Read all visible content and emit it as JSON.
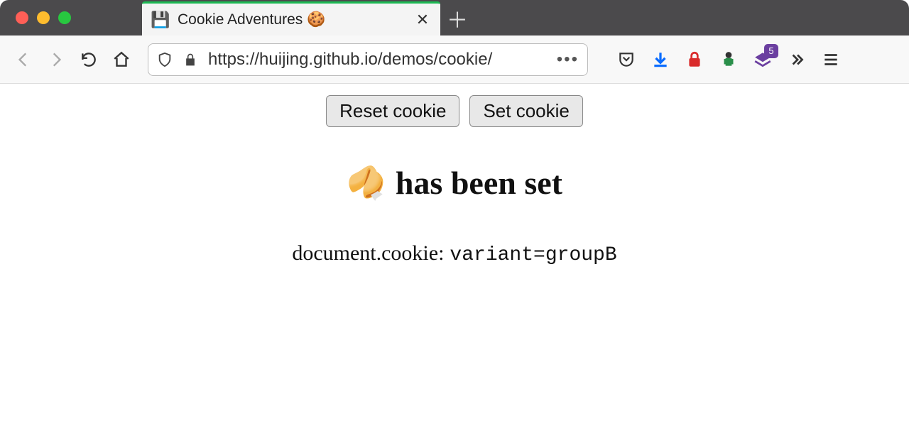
{
  "browser": {
    "tab": {
      "title": "Cookie Adventures 🍪",
      "favicon": "💾"
    },
    "url": "https://huijing.github.io/demos/cookie/",
    "extension_badge": "5"
  },
  "page": {
    "buttons": {
      "reset": "Reset cookie",
      "set": "Set cookie"
    },
    "heading_emoji": "🥠",
    "heading_text": "has been set",
    "cookie_label": "document.cookie:",
    "cookie_value": "variant=groupB"
  }
}
